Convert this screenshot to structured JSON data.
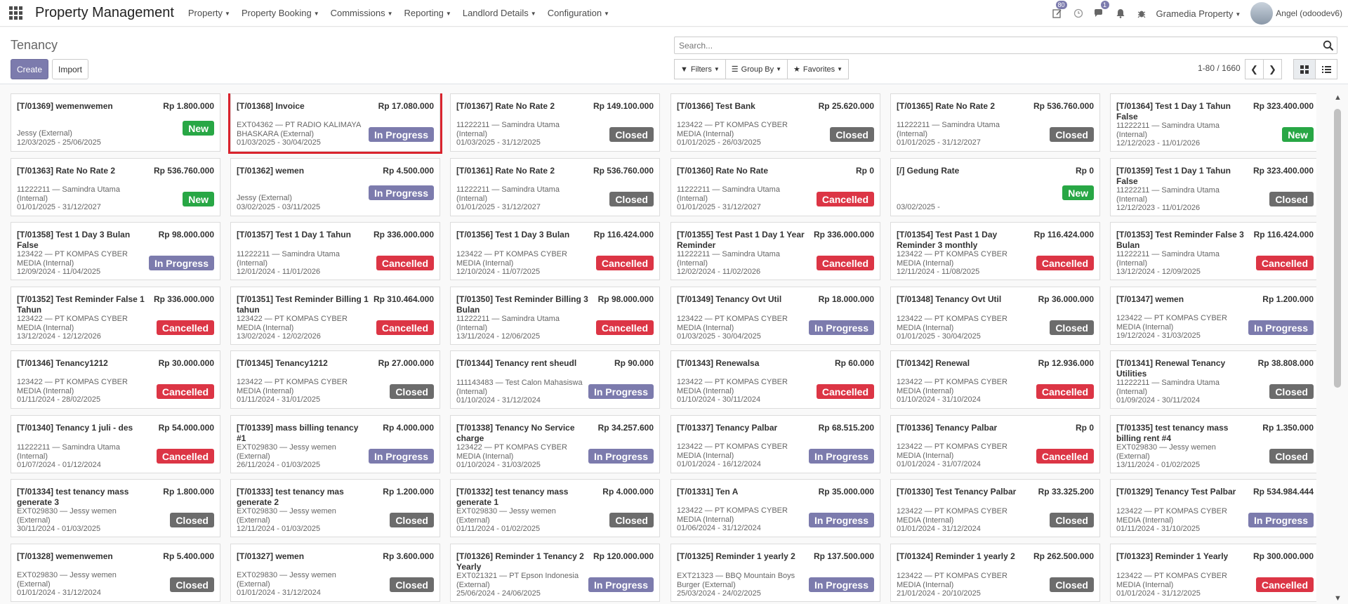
{
  "navbar": {
    "brand": "Property Management",
    "menu": [
      "Property",
      "Property Booking",
      "Commissions",
      "Reporting",
      "Landlord Details",
      "Configuration"
    ],
    "activity_count": "80",
    "messages_count": "1",
    "company": "Gramedia Property",
    "user": "Angel (odoodev6)"
  },
  "control": {
    "breadcrumb": "Tenancy",
    "create_label": "Create",
    "import_label": "Import",
    "search_placeholder": "Search...",
    "filters_label": "Filters",
    "groupby_label": "Group By",
    "favorites_label": "Favorites",
    "pager": "1-80 / 1660"
  },
  "cards": [
    {
      "title": "[T/01369] wemenwemen",
      "amount": "Rp 1.800.000",
      "lines": [
        "Jessy (External)",
        "12/03/2025 - 25/06/2025"
      ],
      "status": "New"
    },
    {
      "title": "[T/01368] Invoice",
      "amount": "Rp 17.080.000",
      "lines": [
        "EXT04362 — PT RADIO KALIMAYA BHASKARA (External)",
        "01/03/2025 - 30/04/2025"
      ],
      "status": "In Progress"
    },
    {
      "title": "[T/01367] Rate No Rate 2",
      "amount": "Rp 149.100.000",
      "lines": [
        "11222211 — Samindra Utama (Internal)",
        "01/03/2025 - 31/12/2025"
      ],
      "status": "Closed"
    },
    {
      "title": "[T/01366] Test Bank",
      "amount": "Rp 25.620.000",
      "lines": [
        "123422 — PT KOMPAS CYBER MEDIA (Internal)",
        "01/01/2025 - 26/03/2025"
      ],
      "status": "Closed"
    },
    {
      "title": "[T/01365] Rate No Rate 2",
      "amount": "Rp 536.760.000",
      "lines": [
        "11222211 — Samindra Utama (Internal)",
        "01/01/2025 - 31/12/2027"
      ],
      "status": "Closed"
    },
    {
      "title": "[T/01364] Test 1 Day 1 Tahun False",
      "amount": "Rp 323.400.000",
      "lines": [
        "11222211 — Samindra Utama (Internal)",
        "12/12/2023 - 11/01/2026"
      ],
      "status": "New"
    },
    {
      "title": "[T/01363] Rate No Rate 2",
      "amount": "Rp 536.760.000",
      "lines": [
        "11222211 — Samindra Utama (Internal)",
        "01/01/2025 - 31/12/2027"
      ],
      "status": "New"
    },
    {
      "title": "[T/01362] wemen",
      "amount": "Rp 4.500.000",
      "lines": [
        "Jessy (External)",
        "03/02/2025 - 03/11/2025"
      ],
      "status": "In Progress"
    },
    {
      "title": "[T/01361] Rate No Rate 2",
      "amount": "Rp 536.760.000",
      "lines": [
        "11222211 — Samindra Utama (Internal)",
        "01/01/2025 - 31/12/2027"
      ],
      "status": "Closed"
    },
    {
      "title": "[T/01360] Rate No Rate",
      "amount": "Rp 0",
      "lines": [
        "11222211 — Samindra Utama (Internal)",
        "01/01/2025 - 31/12/2027"
      ],
      "status": "Cancelled"
    },
    {
      "title": "[/] Gedung Rate",
      "amount": "Rp 0",
      "lines": [
        "03/02/2025 -"
      ],
      "status": "New"
    },
    {
      "title": "[T/01359] Test 1 Day 1 Tahun False",
      "amount": "Rp 323.400.000",
      "lines": [
        "11222211 — Samindra Utama (Internal)",
        "12/12/2023 - 11/01/2026"
      ],
      "status": "Closed"
    },
    {
      "title": "[T/01358] Test 1 Day 3 Bulan False",
      "amount": "Rp 98.000.000",
      "lines": [
        "123422 — PT KOMPAS CYBER MEDIA (Internal)",
        "12/09/2024 - 11/04/2025"
      ],
      "status": "In Progress"
    },
    {
      "title": "[T/01357] Test 1 Day 1 Tahun",
      "amount": "Rp 336.000.000",
      "lines": [
        "11222211 — Samindra Utama (Internal)",
        "12/01/2024 - 11/01/2026"
      ],
      "status": "Cancelled"
    },
    {
      "title": "[T/01356] Test 1 Day 3 Bulan",
      "amount": "Rp 116.424.000",
      "lines": [
        "123422 — PT KOMPAS CYBER MEDIA (Internal)",
        "12/10/2024 - 11/07/2025"
      ],
      "status": "Cancelled"
    },
    {
      "title": "[T/01355] Test Past 1 Day 1 Year Reminder",
      "amount": "Rp 336.000.000",
      "lines": [
        "11222211 — Samindra Utama (Internal)",
        "12/02/2024 - 11/02/2026"
      ],
      "status": "Cancelled"
    },
    {
      "title": "[T/01354] Test Past 1 Day Reminder 3 monthly",
      "amount": "Rp 116.424.000",
      "lines": [
        "123422 — PT KOMPAS CYBER MEDIA (Internal)",
        "12/11/2024 - 11/08/2025"
      ],
      "status": "Cancelled"
    },
    {
      "title": "[T/01353] Test Reminder False 3 Bulan",
      "amount": "Rp 116.424.000",
      "lines": [
        "11222211 — Samindra Utama (Internal)",
        "13/12/2024 - 12/09/2025"
      ],
      "status": "Cancelled"
    },
    {
      "title": "[T/01352] Test Reminder False 1 Tahun",
      "amount": "Rp 336.000.000",
      "lines": [
        "123422 — PT KOMPAS CYBER MEDIA (Internal)",
        "13/12/2024 - 12/12/2026"
      ],
      "status": "Cancelled"
    },
    {
      "title": "[T/01351] Test Reminder Billing 1 tahun",
      "amount": "Rp 310.464.000",
      "lines": [
        "123422 — PT KOMPAS CYBER MEDIA (Internal)",
        "13/02/2024 - 12/02/2026"
      ],
      "status": "Cancelled"
    },
    {
      "title": "[T/01350] Test Reminder Billing 3 Bulan",
      "amount": "Rp 98.000.000",
      "lines": [
        "11222211 — Samindra Utama (Internal)",
        "13/11/2024 - 12/06/2025"
      ],
      "status": "Cancelled"
    },
    {
      "title": "[T/01349] Tenancy Ovt Util",
      "amount": "Rp 18.000.000",
      "lines": [
        "123422 — PT KOMPAS CYBER MEDIA (Internal)",
        "01/03/2025 - 30/04/2025"
      ],
      "status": "In Progress"
    },
    {
      "title": "[T/01348] Tenancy Ovt Util",
      "amount": "Rp 36.000.000",
      "lines": [
        "123422 — PT KOMPAS CYBER MEDIA (Internal)",
        "01/01/2025 - 30/04/2025"
      ],
      "status": "Closed"
    },
    {
      "title": "[T/01347] wemen",
      "amount": "Rp 1.200.000",
      "lines": [
        "123422 — PT KOMPAS CYBER MEDIA (Internal)",
        "19/12/2024 - 31/03/2025"
      ],
      "status": "In Progress"
    },
    {
      "title": "[T/01346] Tenancy1212",
      "amount": "Rp 30.000.000",
      "lines": [
        "123422 — PT KOMPAS CYBER MEDIA (Internal)",
        "01/11/2024 - 28/02/2025"
      ],
      "status": "Cancelled"
    },
    {
      "title": "[T/01345] Tenancy1212",
      "amount": "Rp 27.000.000",
      "lines": [
        "123422 — PT KOMPAS CYBER MEDIA (Internal)",
        "01/11/2024 - 31/01/2025"
      ],
      "status": "Closed"
    },
    {
      "title": "[T/01344] Tenancy rent sheudl",
      "amount": "Rp 90.000",
      "lines": [
        "111143483 — Test Calon Mahasiswa (Internal)",
        "01/10/2024 - 31/12/2024"
      ],
      "status": "In Progress"
    },
    {
      "title": "[T/01343] Renewalsa",
      "amount": "Rp 60.000",
      "lines": [
        "123422 — PT KOMPAS CYBER MEDIA (Internal)",
        "01/10/2024 - 30/11/2024"
      ],
      "status": "Cancelled"
    },
    {
      "title": "[T/01342] Renewal",
      "amount": "Rp 12.936.000",
      "lines": [
        "123422 — PT KOMPAS CYBER MEDIA (Internal)",
        "01/10/2024 - 31/10/2024"
      ],
      "status": "Cancelled"
    },
    {
      "title": "[T/01341] Renewal Tenancy Utilities",
      "amount": "Rp 38.808.000",
      "lines": [
        "11222211 — Samindra Utama (Internal)",
        "01/09/2024 - 30/11/2024"
      ],
      "status": "Closed"
    },
    {
      "title": "[T/01340] Tenancy 1 juli - des",
      "amount": "Rp 54.000.000",
      "lines": [
        "11222211 — Samindra Utama (Internal)",
        "01/07/2024 - 01/12/2024"
      ],
      "status": "Cancelled"
    },
    {
      "title": "[T/01339] mass billing tenancy #1",
      "amount": "Rp 4.000.000",
      "lines": [
        "EXT029830 — Jessy wemen (External)",
        "26/11/2024 - 01/03/2025"
      ],
      "status": "In Progress"
    },
    {
      "title": "[T/01338] Tenancy No Service charge",
      "amount": "Rp 34.257.600",
      "lines": [
        "123422 — PT KOMPAS CYBER MEDIA (Internal)",
        "01/10/2024 - 31/03/2025"
      ],
      "status": "In Progress"
    },
    {
      "title": "[T/01337] Tenancy Palbar",
      "amount": "Rp 68.515.200",
      "lines": [
        "123422 — PT KOMPAS CYBER MEDIA (Internal)",
        "01/01/2024 - 16/12/2024"
      ],
      "status": "In Progress"
    },
    {
      "title": "[T/01336] Tenancy Palbar",
      "amount": "Rp 0",
      "lines": [
        "123422 — PT KOMPAS CYBER MEDIA (Internal)",
        "01/01/2024 - 31/07/2024"
      ],
      "status": "Cancelled"
    },
    {
      "title": "[T/01335] test tenancy mass billing rent #4",
      "amount": "Rp 1.350.000",
      "lines": [
        "EXT029830 — Jessy wemen (External)",
        "13/11/2024 - 01/02/2025"
      ],
      "status": "Closed"
    },
    {
      "title": "[T/01334] test tenancy mass generate 3",
      "amount": "Rp 1.800.000",
      "lines": [
        "EXT029830 — Jessy wemen (External)",
        "30/11/2024 - 01/03/2025"
      ],
      "status": "Closed"
    },
    {
      "title": "[T/01333] test tenancy mas generate 2",
      "amount": "Rp 1.200.000",
      "lines": [
        "EXT029830 — Jessy wemen (External)",
        "12/11/2024 - 01/03/2025"
      ],
      "status": "Closed"
    },
    {
      "title": "[T/01332] test tenancy mass generate 1",
      "amount": "Rp 4.000.000",
      "lines": [
        "EXT029830 — Jessy wemen (External)",
        "01/11/2024 - 01/02/2025"
      ],
      "status": "Closed"
    },
    {
      "title": "[T/01331] Ten A",
      "amount": "Rp 35.000.000",
      "lines": [
        "123422 — PT KOMPAS CYBER MEDIA (Internal)",
        "01/06/2024 - 31/12/2024"
      ],
      "status": "In Progress"
    },
    {
      "title": "[T/01330] Test Tenancy Palbar",
      "amount": "Rp 33.325.200",
      "lines": [
        "123422 — PT KOMPAS CYBER MEDIA (Internal)",
        "01/01/2024 - 31/12/2024"
      ],
      "status": "Closed"
    },
    {
      "title": "[T/01329] Tenancy Test Palbar",
      "amount": "Rp 534.984.444",
      "lines": [
        "123422 — PT KOMPAS CYBER MEDIA (Internal)",
        "01/11/2024 - 31/10/2025"
      ],
      "status": "In Progress"
    },
    {
      "title": "[T/01328] wemenwemen",
      "amount": "Rp 5.400.000",
      "lines": [
        "EXT029830 — Jessy wemen (External)",
        "01/01/2024 - 31/12/2024"
      ],
      "status": "Closed"
    },
    {
      "title": "[T/01327] wemen",
      "amount": "Rp 3.600.000",
      "lines": [
        "EXT029830 — Jessy wemen (External)",
        "01/01/2024 - 31/12/2024"
      ],
      "status": "Closed"
    },
    {
      "title": "[T/01326] Reminder 1 Tenancy 2 Yearly",
      "amount": "Rp 120.000.000",
      "lines": [
        "EXT021321 — PT Epson Indonesia (External)",
        "25/06/2024 - 24/06/2025"
      ],
      "status": "In Progress"
    },
    {
      "title": "[T/01325] Reminder 1 yearly 2",
      "amount": "Rp 137.500.000",
      "lines": [
        "EXT21323 — BBQ Mountain Boys Burger (External)",
        "25/03/2024 - 24/02/2025"
      ],
      "status": "In Progress"
    },
    {
      "title": "[T/01324] Reminder 1 yearly 2",
      "amount": "Rp 262.500.000",
      "lines": [
        "123422 — PT KOMPAS CYBER MEDIA (Internal)",
        "21/01/2024 - 20/10/2025"
      ],
      "status": "Closed"
    },
    {
      "title": "[T/01323] Reminder 1 Yearly",
      "amount": "Rp 300.000.000",
      "lines": [
        "123422 — PT KOMPAS CYBER MEDIA (Internal)",
        "01/01/2024 - 31/12/2025"
      ],
      "status": "Cancelled"
    }
  ],
  "highlighted_card_index": 1
}
